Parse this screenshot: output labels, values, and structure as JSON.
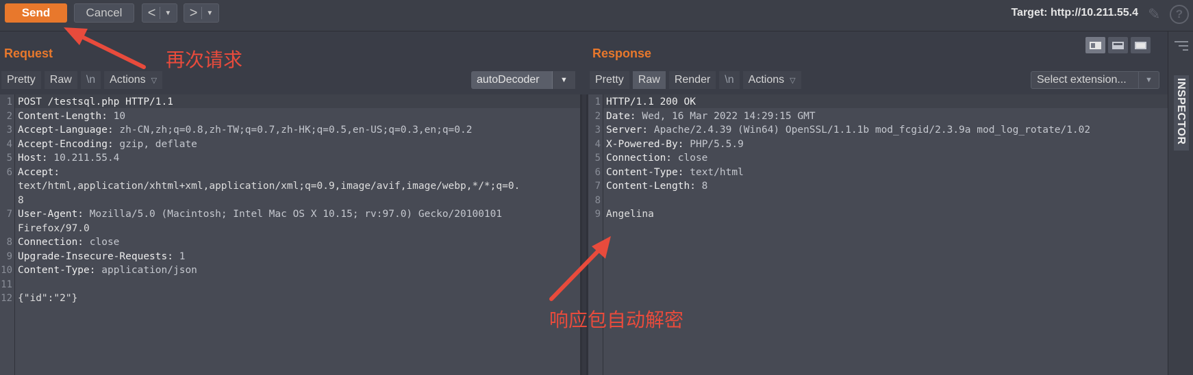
{
  "toolbar": {
    "send_label": "Send",
    "cancel_label": "Cancel",
    "back_glyph": "<",
    "forward_glyph": ">",
    "target_text": "Target: http://10.211.55.4"
  },
  "request": {
    "title": "Request",
    "tabs": [
      "Pretty",
      "Raw",
      "\\n"
    ],
    "actions_label": "Actions",
    "decoder_label": "autoDecoder",
    "line_numbers": [
      "1",
      "2",
      "3",
      "4",
      "5",
      "6",
      "",
      "",
      "7",
      "",
      "8",
      "9",
      "10",
      "11",
      "12"
    ],
    "lines": [
      {
        "k": "POST /testsql.php HTTP/1.1",
        "v": ""
      },
      {
        "k": "Content-Length:",
        "v": " 10"
      },
      {
        "k": "Accept-Language:",
        "v": " zh-CN,zh;q=0.8,zh-TW;q=0.7,zh-HK;q=0.5,en-US;q=0.3,en;q=0.2"
      },
      {
        "k": "Accept-Encoding:",
        "v": " gzip, deflate"
      },
      {
        "k": "Host:",
        "v": " 10.211.55.4"
      },
      {
        "k": "Accept:",
        "v": ""
      },
      {
        "k": "",
        "v": "text/html,application/xhtml+xml,application/xml;q=0.9,image/avif,image/webp,*/*;q=0."
      },
      {
        "k": "",
        "v": "8"
      },
      {
        "k": "User-Agent:",
        "v": " Mozilla/5.0 (Macintosh; Intel Mac OS X 10.15; rv:97.0) Gecko/20100101"
      },
      {
        "k": "",
        "v": "Firefox/97.0"
      },
      {
        "k": "Connection:",
        "v": " close"
      },
      {
        "k": "Upgrade-Insecure-Requests:",
        "v": " 1"
      },
      {
        "k": "Content-Type:",
        "v": " application/json"
      },
      {
        "k": "",
        "v": ""
      },
      {
        "k": "",
        "v": "{\"id\":\"2\"}"
      }
    ]
  },
  "response": {
    "title": "Response",
    "tabs": [
      "Pretty",
      "Raw",
      "Render",
      "\\n"
    ],
    "actions_label": "Actions",
    "extension_label": "Select extension...",
    "line_numbers": [
      "1",
      "2",
      "3",
      "4",
      "5",
      "6",
      "7",
      "8",
      "9"
    ],
    "lines": [
      {
        "k": "HTTP/1.1 200 OK",
        "v": ""
      },
      {
        "k": "Date:",
        "v": " Wed, 16 Mar 2022 14:29:15 GMT"
      },
      {
        "k": "Server:",
        "v": " Apache/2.4.39 (Win64) OpenSSL/1.1.1b mod_fcgid/2.3.9a mod_log_rotate/1.02"
      },
      {
        "k": "X-Powered-By:",
        "v": " PHP/5.5.9"
      },
      {
        "k": "Connection:",
        "v": " close"
      },
      {
        "k": "Content-Type:",
        "v": " text/html"
      },
      {
        "k": "Content-Length:",
        "v": " 8"
      },
      {
        "k": "",
        "v": ""
      },
      {
        "k": "",
        "v": "Angelina"
      }
    ]
  },
  "inspector_label": "INSPECTOR",
  "annotations": {
    "resend": "再次请求",
    "auto_decrypt": "响应包自动解密"
  },
  "colors": {
    "accent": "#e8782c",
    "annotation": "#e84b3c"
  }
}
